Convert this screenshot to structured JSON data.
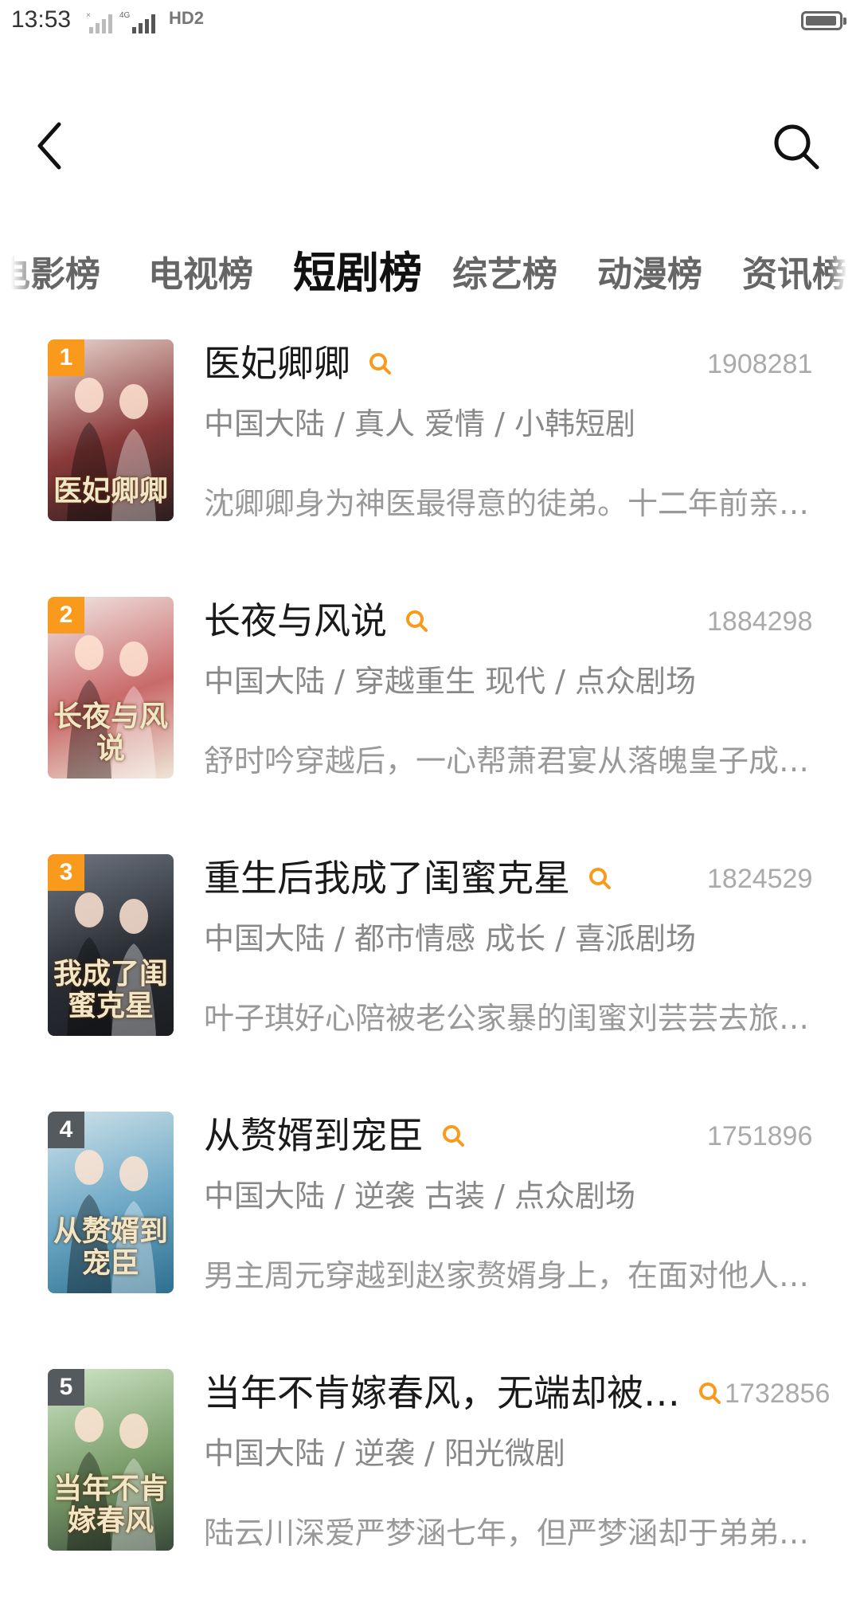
{
  "status_bar": {
    "time": "13:53",
    "network_label": "HD2"
  },
  "header": {
    "back_icon": "chevron-left-icon",
    "search_icon": "search-icon"
  },
  "tabs": [
    {
      "label": "电影榜",
      "active": false
    },
    {
      "label": "电视榜",
      "active": false
    },
    {
      "label": "短剧榜",
      "active": true
    },
    {
      "label": "综艺榜",
      "active": false
    },
    {
      "label": "动漫榜",
      "active": false
    },
    {
      "label": "资讯榜",
      "active": false
    }
  ],
  "list": [
    {
      "rank": "1",
      "title": "医妃卿卿",
      "score": "1908281",
      "meta": "中国大陆 / 真人 爱情 / 小韩短剧",
      "desc": "沈卿卿身为神医最得意的徒弟。十二年前亲…",
      "poster_text": "医妃卿卿",
      "poster_colors": [
        "#e8d6cf",
        "#8a3a3a",
        "#2b1e1e"
      ]
    },
    {
      "rank": "2",
      "title": "长夜与风说",
      "score": "1884298",
      "meta": "中国大陆 / 穿越重生 现代 / 点众剧场",
      "desc": "舒时吟穿越后，一心帮萧君宴从落魄皇子成…",
      "poster_text": "长夜与风说",
      "poster_colors": [
        "#f1e7e4",
        "#c96a6a",
        "#efe6d8"
      ]
    },
    {
      "rank": "3",
      "title": "重生后我成了闺蜜克星",
      "score": "1824529",
      "meta": "中国大陆 / 都市情感 成长 / 喜派剧场",
      "desc": "叶子琪好心陪被老公家暴的闺蜜刘芸芸去旅…",
      "poster_text": "我成了闺蜜克星",
      "poster_colors": [
        "#6e7682",
        "#2b2f36",
        "#1a1c20"
      ]
    },
    {
      "rank": "4",
      "title": "从赘婿到宠臣",
      "score": "1751896",
      "meta": "中国大陆 / 逆袭 古装 / 点众剧场",
      "desc": "男主周元穿越到赵家赘婿身上，在面对他人…",
      "poster_text": "从赘婿到宠臣",
      "poster_colors": [
        "#cfe3ea",
        "#6aa6c4",
        "#2f6f8f"
      ]
    },
    {
      "rank": "5",
      "title": "当年不肯嫁春风，无端却被…",
      "score": "1732856",
      "meta": "中国大陆 / 逆袭 / 阳光微剧",
      "desc": "陆云川深爱严梦涵七年，但严梦涵却于弟弟…",
      "poster_text": "当年不肯嫁春风",
      "poster_colors": [
        "#cfe6c8",
        "#7a9d6a",
        "#3a4a3a"
      ]
    }
  ],
  "colors": {
    "accent": "#f99a1c",
    "rank_top": "#f99a1c",
    "rank_other": "#555a5f"
  }
}
